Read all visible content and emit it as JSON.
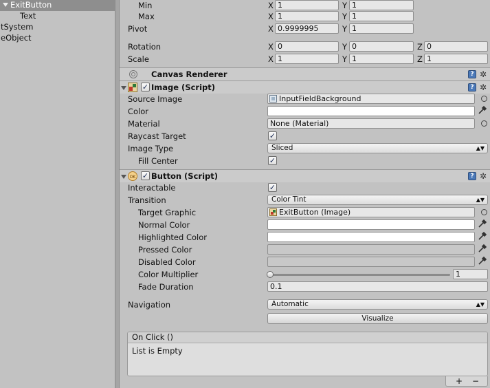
{
  "hierarchy": {
    "items": [
      {
        "label": "ExitButton",
        "selected": true
      },
      {
        "label": "Text"
      },
      {
        "label": "tSystem"
      },
      {
        "label": "eObject"
      }
    ]
  },
  "rect_transform": {
    "min": {
      "label": "Min",
      "x": "1",
      "y": "1"
    },
    "max": {
      "label": "Max",
      "x": "1",
      "y": "1"
    },
    "pivot": {
      "label": "Pivot",
      "x": "0.9999995",
      "y": "1"
    },
    "rotation": {
      "label": "Rotation",
      "x": "0",
      "y": "0",
      "z": "0"
    },
    "scale": {
      "label": "Scale",
      "x": "1",
      "y": "1",
      "z": "1"
    }
  },
  "axes": {
    "x": "X",
    "y": "Y",
    "z": "Z"
  },
  "canvas_renderer": {
    "title": "Canvas Renderer"
  },
  "image": {
    "title": "Image (Script)",
    "source_image_label": "Source Image",
    "source_image_value": "InputFieldBackground",
    "color_label": "Color",
    "material_label": "Material",
    "material_value": "None (Material)",
    "raycast_label": "Raycast Target",
    "image_type_label": "Image Type",
    "image_type_value": "Sliced",
    "fill_center_label": "Fill Center"
  },
  "button": {
    "title": "Button (Script)",
    "interactable_label": "Interactable",
    "transition_label": "Transition",
    "transition_value": "Color Tint",
    "target_graphic_label": "Target Graphic",
    "target_graphic_value": "ExitButton (Image)",
    "normal_color_label": "Normal Color",
    "highlighted_color_label": "Highlighted Color",
    "pressed_color_label": "Pressed Color",
    "disabled_color_label": "Disabled Color",
    "color_multiplier_label": "Color Multiplier",
    "color_multiplier_value": "1",
    "fade_duration_label": "Fade Duration",
    "fade_duration_value": "0.1",
    "navigation_label": "Navigation",
    "navigation_value": "Automatic",
    "visualize_label": "Visualize"
  },
  "on_click": {
    "title": "On Click ()",
    "empty_text": "List is Empty",
    "add": "+",
    "remove": "−"
  },
  "colors": {
    "white_swatch": "#ffffff",
    "pressed_swatch": "#c8c8c8",
    "disabled_swatch": "#c8c8c8",
    "selection": "#8e8e8e"
  }
}
